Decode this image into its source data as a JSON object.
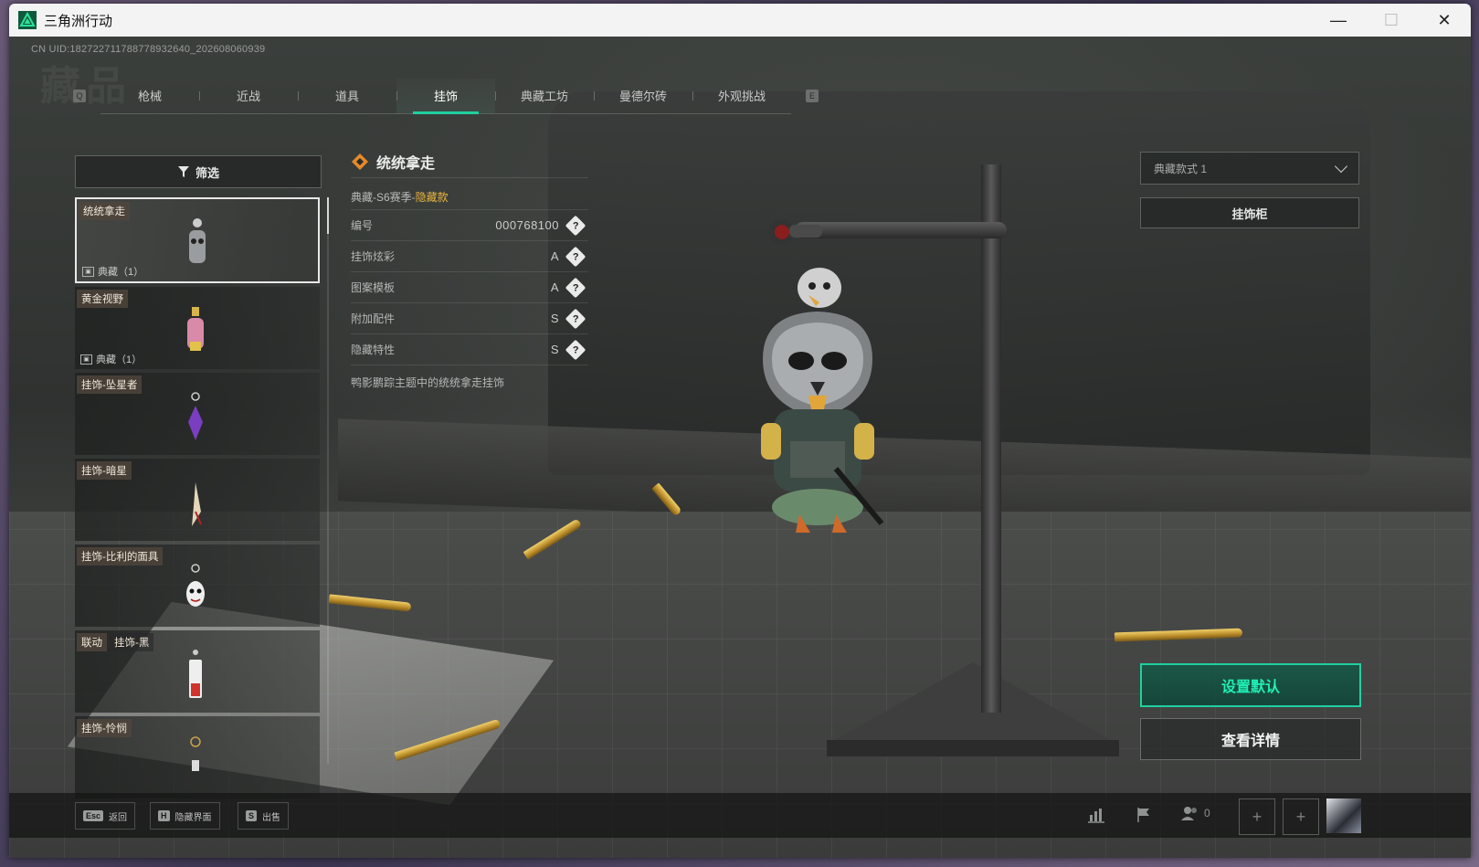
{
  "window": {
    "title": "三角洲行动",
    "controls": {
      "minimize": "—",
      "maximize": "☐",
      "close": "✕"
    }
  },
  "uid": "CN UID:18272271178877893264​0_202608060939",
  "bg_title": "藏品",
  "tabs": {
    "left_key": "Q",
    "right_key": "E",
    "items": [
      {
        "label": "枪械",
        "active": false
      },
      {
        "label": "近战",
        "active": false
      },
      {
        "label": "道具",
        "active": false
      },
      {
        "label": "挂饰",
        "active": true
      },
      {
        "label": "典藏工坊",
        "active": false
      },
      {
        "label": "曼德尔砖",
        "active": false
      },
      {
        "label": "外观挑战",
        "active": false
      }
    ]
  },
  "filter": {
    "label": "筛选",
    "icon": "filter-icon"
  },
  "items": [
    {
      "label": "统统拿走",
      "badge": "典藏（1）",
      "selected": true
    },
    {
      "label": "黄金视野",
      "badge": "典藏（1）",
      "selected": false
    },
    {
      "label": "挂饰-坠星者",
      "badge": "",
      "selected": false
    },
    {
      "label": "挂饰-暗星",
      "badge": "",
      "selected": false
    },
    {
      "label": "挂饰-比利的面具",
      "badge": "",
      "selected": false
    },
    {
      "label": "联动",
      "label2": "挂饰-黑",
      "badge": "",
      "selected": false
    },
    {
      "label": "挂饰-怜悯",
      "badge": "",
      "selected": false
    }
  ],
  "detail": {
    "title": "统统拿走",
    "season_prefix": "典藏-S6赛季-",
    "season_hidden": "隐藏款",
    "rows": [
      {
        "key": "编号",
        "value": "000768100"
      },
      {
        "key": "挂饰炫彩",
        "value": "A"
      },
      {
        "key": "图案模板",
        "value": "A"
      },
      {
        "key": "附加配件",
        "value": "S"
      },
      {
        "key": "隐藏特性",
        "value": "S"
      }
    ],
    "help_glyph": "?",
    "description": "鸭影鹏踪主题中的统统拿走挂饰"
  },
  "right_panel": {
    "dropdown_value": "典藏款式 1",
    "rack_label": "挂饰柜"
  },
  "actions": {
    "set_default": "设置默认",
    "view_detail": "查看详情"
  },
  "bottombar": {
    "back": {
      "key": "Esc",
      "label": "返回"
    },
    "hide_ui": {
      "key": "H",
      "label": "隐藏界面"
    },
    "sell": {
      "key": "S",
      "label": "出售"
    },
    "friends_count": "0",
    "slot_plus": "+"
  },
  "colors": {
    "accent": "#1fd0a0",
    "hidden_gold": "#e9b43c"
  }
}
